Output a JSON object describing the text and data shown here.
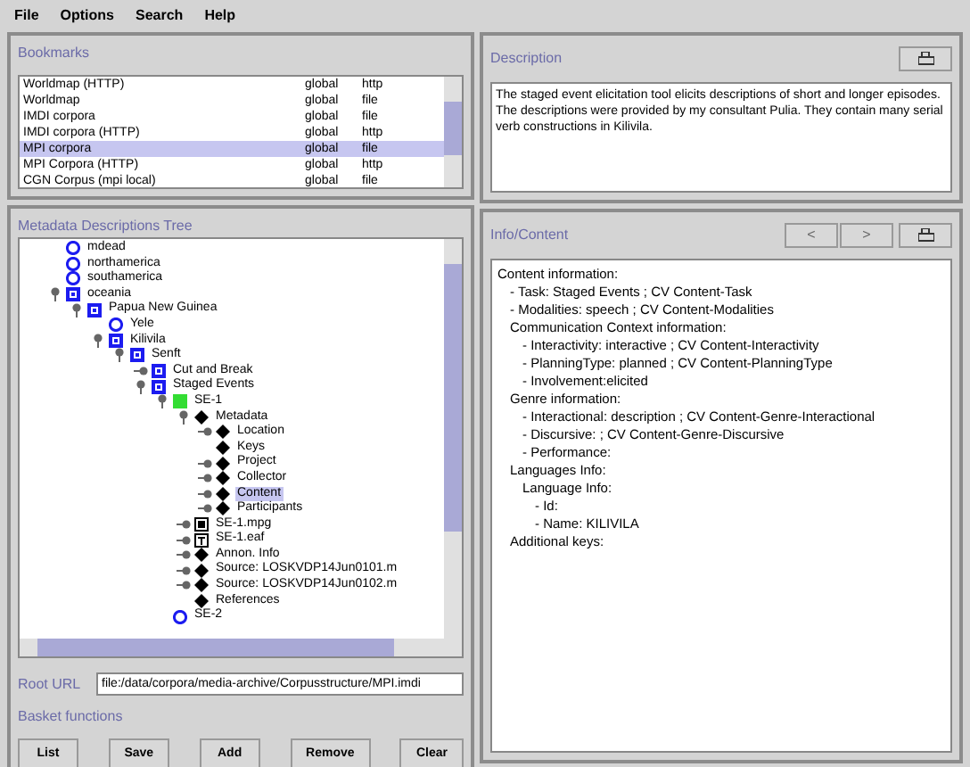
{
  "menu": [
    "File",
    "Options",
    "Search",
    "Help"
  ],
  "bookmarks": {
    "title": "Bookmarks",
    "rows": [
      {
        "name": "Worldmap (HTTP)",
        "scope": "global",
        "type": "http",
        "selected": false
      },
      {
        "name": "Worldmap",
        "scope": "global",
        "type": "file",
        "selected": false
      },
      {
        "name": "IMDI corpora",
        "scope": "global",
        "type": "file",
        "selected": false
      },
      {
        "name": "IMDI corpora (HTTP)",
        "scope": "global",
        "type": "http",
        "selected": false
      },
      {
        "name": "MPI corpora",
        "scope": "global",
        "type": "file",
        "selected": true
      },
      {
        "name": "MPI Corpora (HTTP)",
        "scope": "global",
        "type": "http",
        "selected": false
      },
      {
        "name": "CGN Corpus (mpi local)",
        "scope": "global",
        "type": "file",
        "selected": false
      }
    ]
  },
  "tree": {
    "title": "Metadata Descriptions Tree",
    "nodes": [
      {
        "label": "mdead",
        "kind": "circle",
        "selected": false
      },
      {
        "label": "northamerica",
        "kind": "circle",
        "selected": false
      },
      {
        "label": "southamerica",
        "kind": "circle",
        "selected": false
      },
      {
        "label": "oceania",
        "kind": "square",
        "expanded": true,
        "selected": false,
        "children": [
          {
            "label": "Papua New Guinea",
            "kind": "square",
            "expanded": true,
            "selected": false,
            "children": [
              {
                "label": "Yele",
                "kind": "circle",
                "selected": false
              },
              {
                "label": "Kilivila",
                "kind": "square",
                "expanded": true,
                "selected": false,
                "children": [
                  {
                    "label": "Senft",
                    "kind": "square",
                    "expanded": true,
                    "selected": false,
                    "children": [
                      {
                        "label": "Cut and Break",
                        "kind": "square",
                        "expanded": false,
                        "selected": false
                      },
                      {
                        "label": "Staged Events",
                        "kind": "square",
                        "expanded": true,
                        "selected": false,
                        "children": [
                          {
                            "label": "SE-1",
                            "kind": "session",
                            "expanded": true,
                            "selected": false,
                            "children": [
                              {
                                "label": "Metadata",
                                "kind": "diamond",
                                "expanded": true,
                                "selected": false,
                                "children": [
                                  {
                                    "label": "Location",
                                    "kind": "diamond",
                                    "expanded": false,
                                    "selected": false
                                  },
                                  {
                                    "label": "Keys",
                                    "kind": "diamond",
                                    "selected": false
                                  },
                                  {
                                    "label": "Project",
                                    "kind": "diamond",
                                    "expanded": false,
                                    "selected": false
                                  },
                                  {
                                    "label": "Collector",
                                    "kind": "diamond",
                                    "expanded": false,
                                    "selected": false
                                  },
                                  {
                                    "label": "Content",
                                    "kind": "diamond",
                                    "expanded": false,
                                    "selected": true
                                  },
                                  {
                                    "label": "Participants",
                                    "kind": "diamond",
                                    "expanded": false,
                                    "selected": false
                                  }
                                ]
                              },
                              {
                                "label": "SE-1.mpg",
                                "kind": "media",
                                "expanded": false,
                                "selected": false
                              },
                              {
                                "label": "SE-1.eaf",
                                "kind": "text",
                                "expanded": false,
                                "selected": false
                              },
                              {
                                "label": "Annon. Info",
                                "kind": "diamond",
                                "expanded": false,
                                "selected": false
                              },
                              {
                                "label": "Source: LOSKVDP14Jun0101.m",
                                "kind": "diamond",
                                "expanded": false,
                                "selected": false
                              },
                              {
                                "label": "Source: LOSKVDP14Jun0102.m",
                                "kind": "diamond",
                                "expanded": false,
                                "selected": false
                              },
                              {
                                "label": "References",
                                "kind": "diamond",
                                "selected": false
                              }
                            ]
                          },
                          {
                            "label": "SE-2",
                            "kind": "circle",
                            "selected": false
                          }
                        ]
                      }
                    ]
                  }
                ]
              }
            ]
          }
        ]
      }
    ]
  },
  "root_url": {
    "label": "Root URL",
    "value": "file:/data/corpora/media-archive/Corpusstructure/MPI.imdi"
  },
  "basket": {
    "title": "Basket functions",
    "buttons": [
      "List",
      "Save",
      "Add",
      "Remove",
      "Clear"
    ]
  },
  "description": {
    "title": "Description",
    "text": "The staged event elicitation tool elicits descriptions of short and longer episodes. The descriptions were provided by my consultant Pulia. They contain many  serial verb constructions in Kilivila."
  },
  "info": {
    "title": "Info/Content",
    "nav": [
      "<",
      ">"
    ],
    "lines": [
      {
        "text": "Content information:",
        "children": [
          {
            "text": "- Task: Staged Events ; CV Content-Task"
          },
          {
            "text": "- Modalities: speech ; CV Content-Modalities"
          },
          {
            "text": "Communication Context information:",
            "children": [
              {
                "text": "- Interactivity: interactive ; CV Content-Interactivity"
              },
              {
                "text": "- PlanningType: planned ; CV Content-PlanningType"
              },
              {
                "text": "- Involvement:elicited"
              }
            ]
          },
          {
            "text": "Genre information:",
            "children": [
              {
                "text": "- Interactional: description ; CV Content-Genre-Interactional"
              },
              {
                "text": "- Discursive:  ; CV Content-Genre-Discursive"
              },
              {
                "text": "- Performance:"
              }
            ]
          },
          {
            "text": "Languages Info:",
            "children": [
              {
                "text": "Language Info:",
                "children": [
                  {
                    "text": "- Id:"
                  },
                  {
                    "text": "- Name: KILIVILA"
                  }
                ]
              }
            ]
          },
          {
            "text": "Additional keys:"
          }
        ]
      }
    ]
  }
}
